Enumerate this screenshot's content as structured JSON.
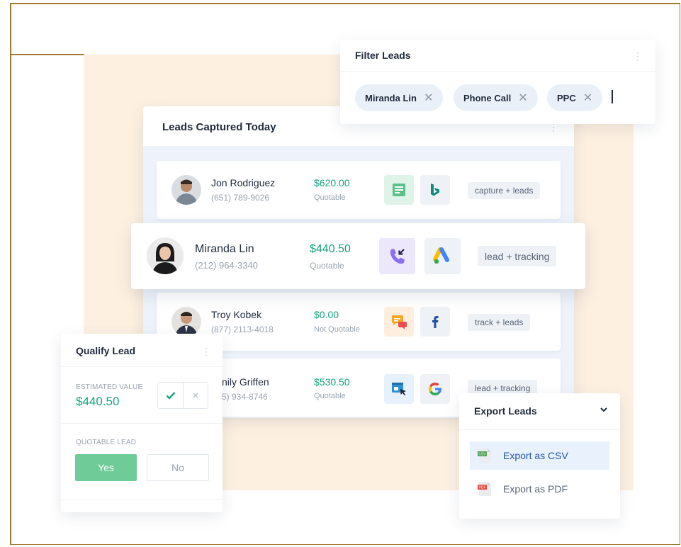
{
  "filter": {
    "title": "Filter Leads",
    "chips": [
      "Miranda Lin",
      "Phone Call",
      "PPC"
    ]
  },
  "leads": {
    "title": "Leads Captured Today",
    "rows": [
      {
        "name": "Jon Rodriguez",
        "phone": "(651) 789-9026",
        "amount": "$620.00",
        "status": "Quotable",
        "tag": "capture + leads",
        "icons": [
          "form-icon",
          "bing-icon"
        ]
      },
      {
        "name": "Miranda Lin",
        "phone": "(212) 964-3340",
        "amount": "$440.50",
        "status": "Quotable",
        "tag": "lead + tracking",
        "icons": [
          "phone-call-icon",
          "google-ads-icon"
        ]
      },
      {
        "name": "Troy Kobek",
        "phone": "(877) 2113-4018",
        "amount": "$0.00",
        "status": "Not Quotable",
        "tag": "track + leads",
        "icons": [
          "chat-icon",
          "facebook-icon"
        ]
      },
      {
        "name": "nily Griffen",
        "phone": "5) 934-8746",
        "amount": "$530.50",
        "status": "Quotable",
        "tag": "lead + tracking",
        "icons": [
          "web-click-icon",
          "google-icon"
        ]
      }
    ]
  },
  "qualify": {
    "title": "Qualify Lead",
    "estimated_label": "ESTIMATED VALUE",
    "estimated_value": "$440.50",
    "quotable_label": "QUOTABLE LEAD",
    "yes_label": "Yes",
    "no_label": "No"
  },
  "export": {
    "title": "Export Leads",
    "items": [
      {
        "label": "Export as CSV",
        "badge": "CSV"
      },
      {
        "label": "Export as PDF",
        "badge": "PDF"
      }
    ]
  },
  "colors": {
    "accent_green": "#14a37f",
    "yes_green": "#6fcb97",
    "export_blue": "#2057a7",
    "peach": "#fdf0e1"
  }
}
